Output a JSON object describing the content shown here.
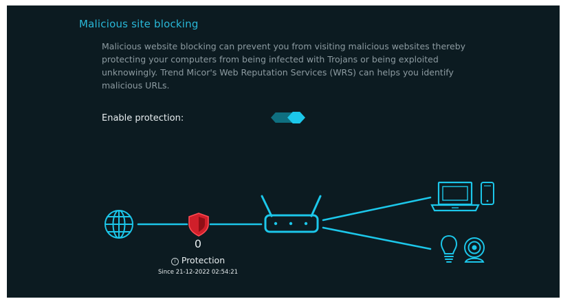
{
  "section": {
    "title": "Malicious site blocking",
    "description": "Malicious website blocking can prevent you from visiting malicious websites thereby protecting your computers from being infected with Trojans or being exploited unknowingly. Trend Micor's Web Reputation Services (WRS) can helps you identify malicious URLs."
  },
  "protection": {
    "enable_label": "Enable protection:",
    "enabled": true,
    "count": "0",
    "status_label": "Protection",
    "info_glyph": "i",
    "since": "Since 21-12-2022 02:54:21"
  },
  "colors": {
    "accent": "#1cc7ea",
    "title": "#29b8d8",
    "shield": "#d01f2a",
    "background": "#0c1b21"
  },
  "icons": [
    "globe-icon",
    "shield-icon",
    "router-icon",
    "laptop-icon",
    "phone-icon",
    "lightbulb-icon",
    "webcam-icon"
  ]
}
